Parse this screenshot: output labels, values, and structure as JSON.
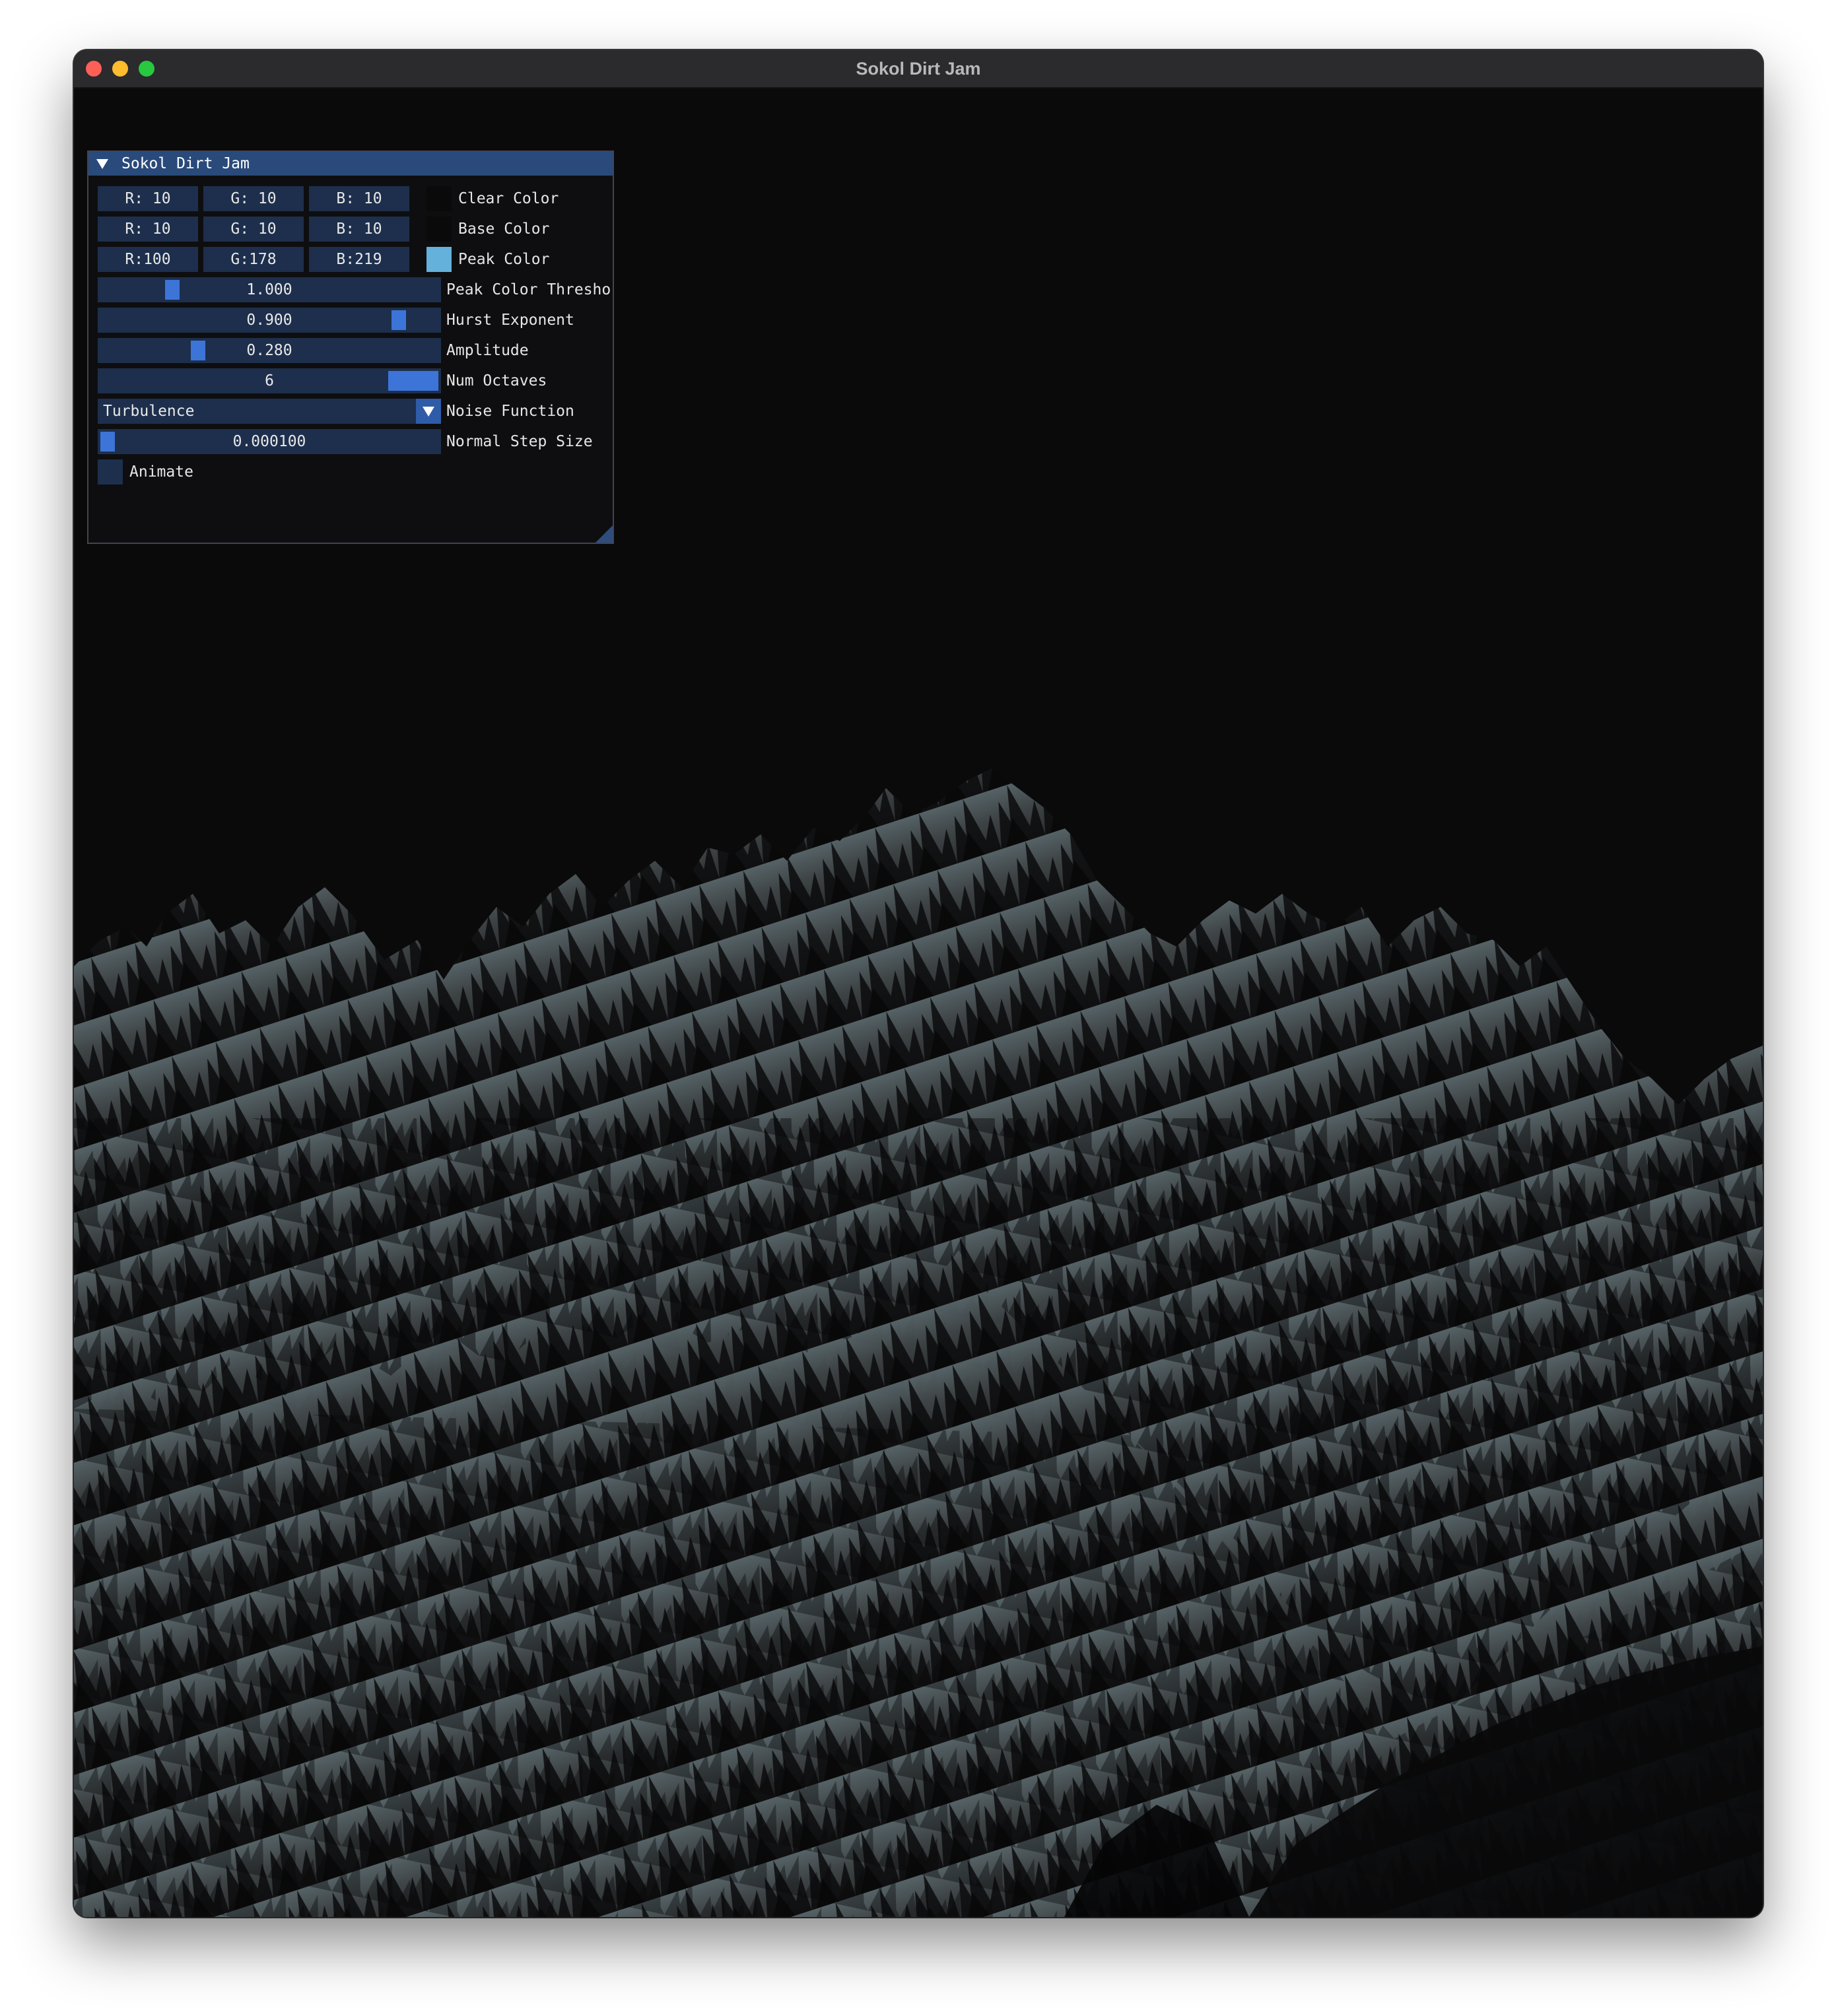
{
  "window": {
    "title": "Sokol Dirt Jam"
  },
  "panel": {
    "title": "Sokol Dirt Jam",
    "clear_color": {
      "r": "R: 10",
      "g": "G: 10",
      "b": "B: 10",
      "swatch": "#0a0a0a",
      "label": "Clear Color"
    },
    "base_color": {
      "r": "R: 10",
      "g": "G: 10",
      "b": "B: 10",
      "swatch": "#0a0a0a",
      "label": "Base Color"
    },
    "peak_color": {
      "r": "R:100",
      "g": "G:178",
      "b": "B:219",
      "swatch": "#64b2db",
      "label": "Peak Color"
    },
    "peak_color_threshold": {
      "value": "1.000",
      "label": "Peak Color Thresho",
      "level": 0.2
    },
    "hurst_exponent": {
      "value": "0.900",
      "label": "Hurst Exponent",
      "level": 0.9
    },
    "amplitude": {
      "value": "0.280",
      "label": "Amplitude",
      "level": 0.28
    },
    "num_octaves": {
      "value": "6",
      "label": "Num Octaves",
      "level": 1.0
    },
    "noise_function": {
      "value": "Turbulence",
      "label": "Noise Function"
    },
    "normal_step_size": {
      "value": "0.000100",
      "label": "Normal Step Size",
      "level": 0.0
    },
    "animate": {
      "label": "Animate",
      "checked": false
    }
  },
  "colors": {
    "accent": "#3d74d8",
    "frame_bg": "#1d2f4c",
    "title_bg": "#294a7a"
  }
}
